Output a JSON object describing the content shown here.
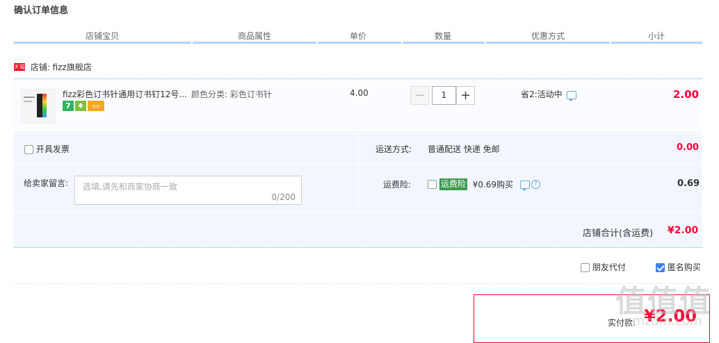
{
  "page_title": "确认订单信息",
  "columns": [
    "店铺宝贝",
    "商品属性",
    "单价",
    "数量",
    "优惠方式",
    "小计"
  ],
  "shop": {
    "badge": "天猫",
    "label": "店铺: fizz旗舰店"
  },
  "item": {
    "name": "fizz彩色订书针通用订书钉12号...",
    "attr": "颜色分类: 彩色订书针",
    "badge_seven": "7",
    "unit_price": "4.00",
    "quantity": "1",
    "minus": "−",
    "plus": "+",
    "promo": "省2:活动中",
    "subtotal": "2.00"
  },
  "invoice_label": "开具发票",
  "shipping": {
    "label": "运送方式:",
    "value": "普通配送 快递 免邮",
    "fee": "0.00"
  },
  "message": {
    "label": "给卖家留言:",
    "placeholder": "选填,请先和商家协商一致",
    "count": "0/200"
  },
  "insurance": {
    "label": "运费险:",
    "tag": "运费险",
    "price": "¥0.69购买",
    "help": "?",
    "fee": "0.69"
  },
  "shop_total": {
    "label": "店铺合计(含运费)",
    "value": "¥2.00"
  },
  "options": {
    "friend_pay": "朋友代付",
    "anonymous": "匿名购买"
  },
  "payment": {
    "label": "实付款:",
    "value": "¥2.00"
  },
  "watermark": {
    "main": "值值值",
    "sub": "smzdm.com"
  }
}
